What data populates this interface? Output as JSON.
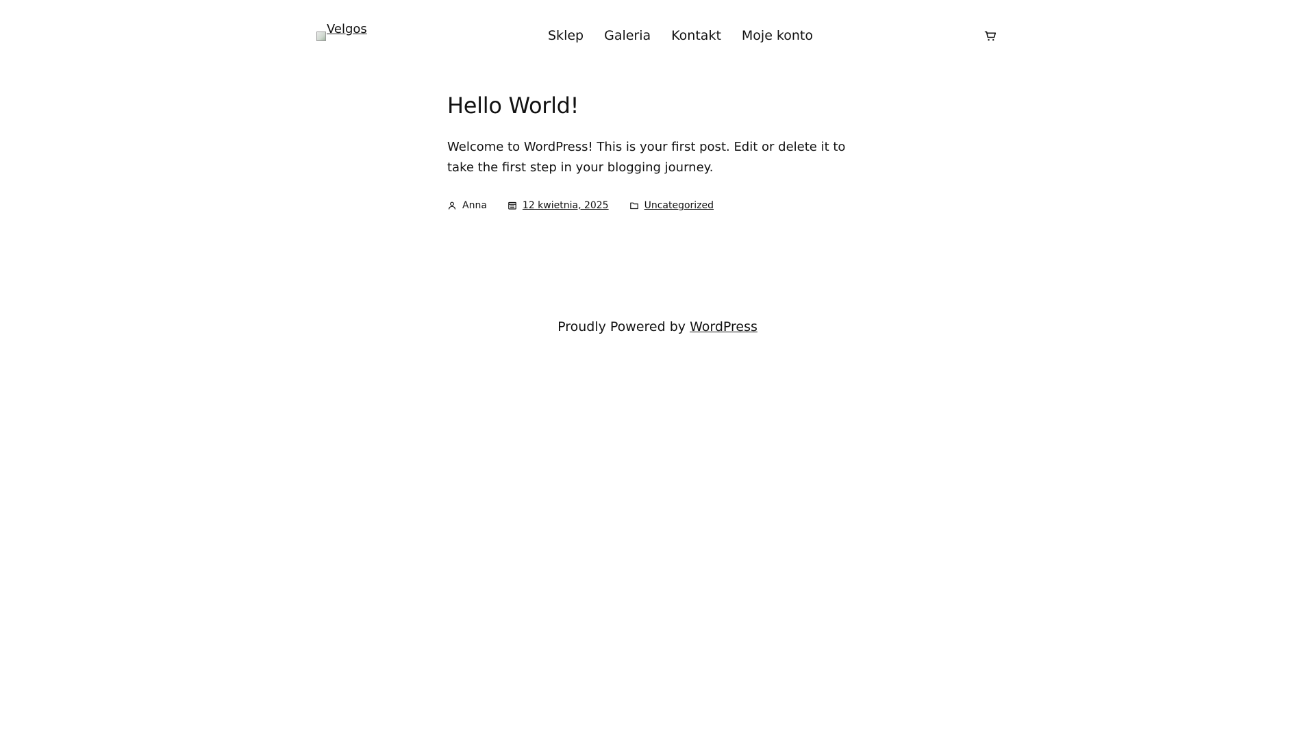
{
  "header": {
    "logo_alt": "Velgos",
    "nav": [
      {
        "label": "Sklep"
      },
      {
        "label": "Galeria"
      },
      {
        "label": "Kontakt"
      },
      {
        "label": "Moje konto"
      }
    ],
    "cart_icon": "cart-icon"
  },
  "post": {
    "title": "Hello World!",
    "excerpt": "Welcome to WordPress! This is your first post. Edit or delete it to take the first step in your blogging journey.",
    "author": "Anna",
    "date": "12 kwietnia, 2025",
    "category": "Uncategorized"
  },
  "footer": {
    "prefix": "Proudly Powered by ",
    "link": "WordPress"
  },
  "icons": {
    "author": "person-icon",
    "date": "calendar-icon",
    "category": "folder-icon",
    "logo": "broken-image-icon"
  }
}
